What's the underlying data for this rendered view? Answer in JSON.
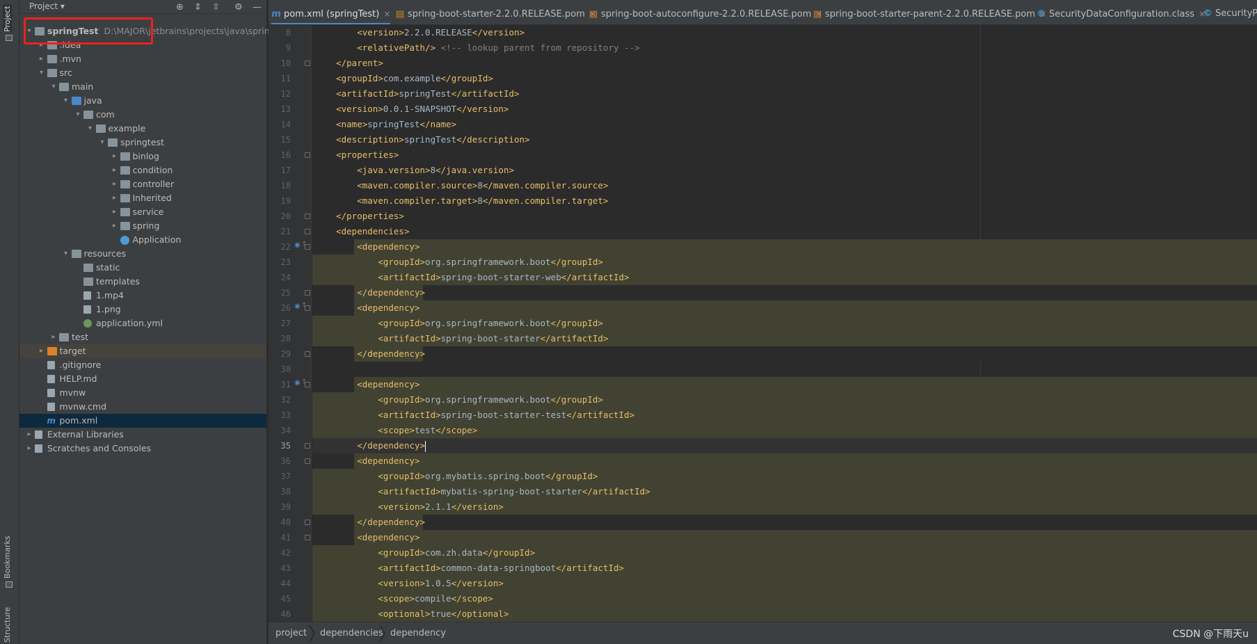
{
  "sidebar_tabs": {
    "project": "Project",
    "bookmarks": "Bookmarks",
    "structure": "Structure"
  },
  "project_panel": {
    "title": "Project",
    "tree": [
      {
        "label": "springTest",
        "path": "D:\\MAJOR\\jetbrains\\projects\\java\\spring",
        "depth": 0,
        "type": "module",
        "expanded": true
      },
      {
        "label": ".idea",
        "depth": 1,
        "type": "folder",
        "expanded": false
      },
      {
        "label": ".mvn",
        "depth": 1,
        "type": "folder",
        "expanded": false
      },
      {
        "label": "src",
        "depth": 1,
        "type": "folder",
        "expanded": true
      },
      {
        "label": "main",
        "depth": 2,
        "type": "folder",
        "expanded": true
      },
      {
        "label": "java",
        "depth": 3,
        "type": "source-folder",
        "expanded": true
      },
      {
        "label": "com",
        "depth": 4,
        "type": "package",
        "expanded": true
      },
      {
        "label": "example",
        "depth": 5,
        "type": "package",
        "expanded": true
      },
      {
        "label": "springtest",
        "depth": 6,
        "type": "package",
        "expanded": true
      },
      {
        "label": "binlog",
        "depth": 7,
        "type": "package",
        "expanded": false
      },
      {
        "label": "condition",
        "depth": 7,
        "type": "package",
        "expanded": false
      },
      {
        "label": "controller",
        "depth": 7,
        "type": "package",
        "expanded": false
      },
      {
        "label": "Inherited",
        "depth": 7,
        "type": "package",
        "expanded": false
      },
      {
        "label": "service",
        "depth": 7,
        "type": "package",
        "expanded": false
      },
      {
        "label": "spring",
        "depth": 7,
        "type": "package",
        "expanded": false
      },
      {
        "label": "Application",
        "depth": 7,
        "type": "class"
      },
      {
        "label": "resources",
        "depth": 3,
        "type": "resources-folder",
        "expanded": true
      },
      {
        "label": "static",
        "depth": 4,
        "type": "folder"
      },
      {
        "label": "templates",
        "depth": 4,
        "type": "folder"
      },
      {
        "label": "1.mp4",
        "depth": 4,
        "type": "file"
      },
      {
        "label": "1.png",
        "depth": 4,
        "type": "file"
      },
      {
        "label": "application.yml",
        "depth": 4,
        "type": "yml"
      },
      {
        "label": "test",
        "depth": 2,
        "type": "folder",
        "expanded": false
      },
      {
        "label": "target",
        "depth": 1,
        "type": "excluded-folder",
        "expanded": false,
        "highlighted": true
      },
      {
        "label": ".gitignore",
        "depth": 1,
        "type": "file"
      },
      {
        "label": "HELP.md",
        "depth": 1,
        "type": "file"
      },
      {
        "label": "mvnw",
        "depth": 1,
        "type": "file"
      },
      {
        "label": "mvnw.cmd",
        "depth": 1,
        "type": "file"
      },
      {
        "label": "pom.xml",
        "depth": 1,
        "type": "maven",
        "selected": true
      },
      {
        "label": "External Libraries",
        "depth": 0,
        "type": "libraries",
        "expanded": false
      },
      {
        "label": "Scratches and Consoles",
        "depth": 0,
        "type": "scratches",
        "expanded": false
      }
    ]
  },
  "editor_tabs": [
    {
      "label": "pom.xml (springTest)",
      "icon": "maven-icon",
      "active": true
    },
    {
      "label": "spring-boot-starter-2.2.0.RELEASE.pom",
      "icon": "pom-icon"
    },
    {
      "label": "spring-boot-autoconfigure-2.2.0.RELEASE.pom",
      "icon": "pom-icon"
    },
    {
      "label": "spring-boot-starter-parent-2.2.0.RELEASE.pom",
      "icon": "pom-icon"
    },
    {
      "label": "SecurityDataConfiguration.class",
      "icon": "class-icon"
    },
    {
      "label": "SecurityPro",
      "icon": "class-icon"
    }
  ],
  "code": {
    "first_line_number": 8,
    "current_line": 35,
    "lines": [
      "        <version>2.2.0.RELEASE</version>",
      "        <relativePath/> <!-- lookup parent from repository -->",
      "    </parent>",
      "    <groupId>com.example</groupId>",
      "    <artifactId>springTest</artifactId>",
      "    <version>0.0.1-SNAPSHOT</version>",
      "    <name>springTest</name>",
      "    <description>springTest</description>",
      "    <properties>",
      "        <java.version>8</java.version>",
      "        <maven.compiler.source>8</maven.compiler.source>",
      "        <maven.compiler.target>8</maven.compiler.target>",
      "    </properties>",
      "    <dependencies>",
      "        <dependency>",
      "            <groupId>org.springframework.boot</groupId>",
      "            <artifactId>spring-boot-starter-web</artifactId>",
      "        </dependency>",
      "        <dependency>",
      "            <groupId>org.springframework.boot</groupId>",
      "            <artifactId>spring-boot-starter</artifactId>",
      "        </dependency>",
      "",
      "        <dependency>",
      "            <groupId>org.springframework.boot</groupId>",
      "            <artifactId>spring-boot-starter-test</artifactId>",
      "            <scope>test</scope>",
      "        </dependency>",
      "        <dependency>",
      "            <groupId>org.mybatis.spring.boot</groupId>",
      "            <artifactId>mybatis-spring-boot-starter</artifactId>",
      "            <version>2.1.1</version>",
      "        </dependency>",
      "        <dependency>",
      "            <groupId>com.zh.data</groupId>",
      "            <artifactId>common-data-springboot</artifactId>",
      "            <version>1.0.5</version>",
      "            <scope>compile</scope>",
      "            <optional>true</optional>"
    ],
    "highlighted_dependency_lines": [
      22,
      23,
      24,
      25,
      26,
      27,
      28,
      29,
      31,
      32,
      33,
      34,
      35,
      36,
      37,
      38,
      39,
      40,
      41,
      42,
      43,
      44,
      45,
      46
    ],
    "gutter_markers": [
      22,
      26,
      31
    ]
  },
  "breadcrumb": [
    "project",
    "dependencies",
    "dependency"
  ],
  "watermark": "CSDN @下雨天u",
  "colors": {
    "annotation_box": "#e8231e",
    "tag": "#e8bf6a",
    "text": "#a9b7c6",
    "comment": "#808080",
    "selection": "#0d293e",
    "dep_highlight": "#414232"
  }
}
